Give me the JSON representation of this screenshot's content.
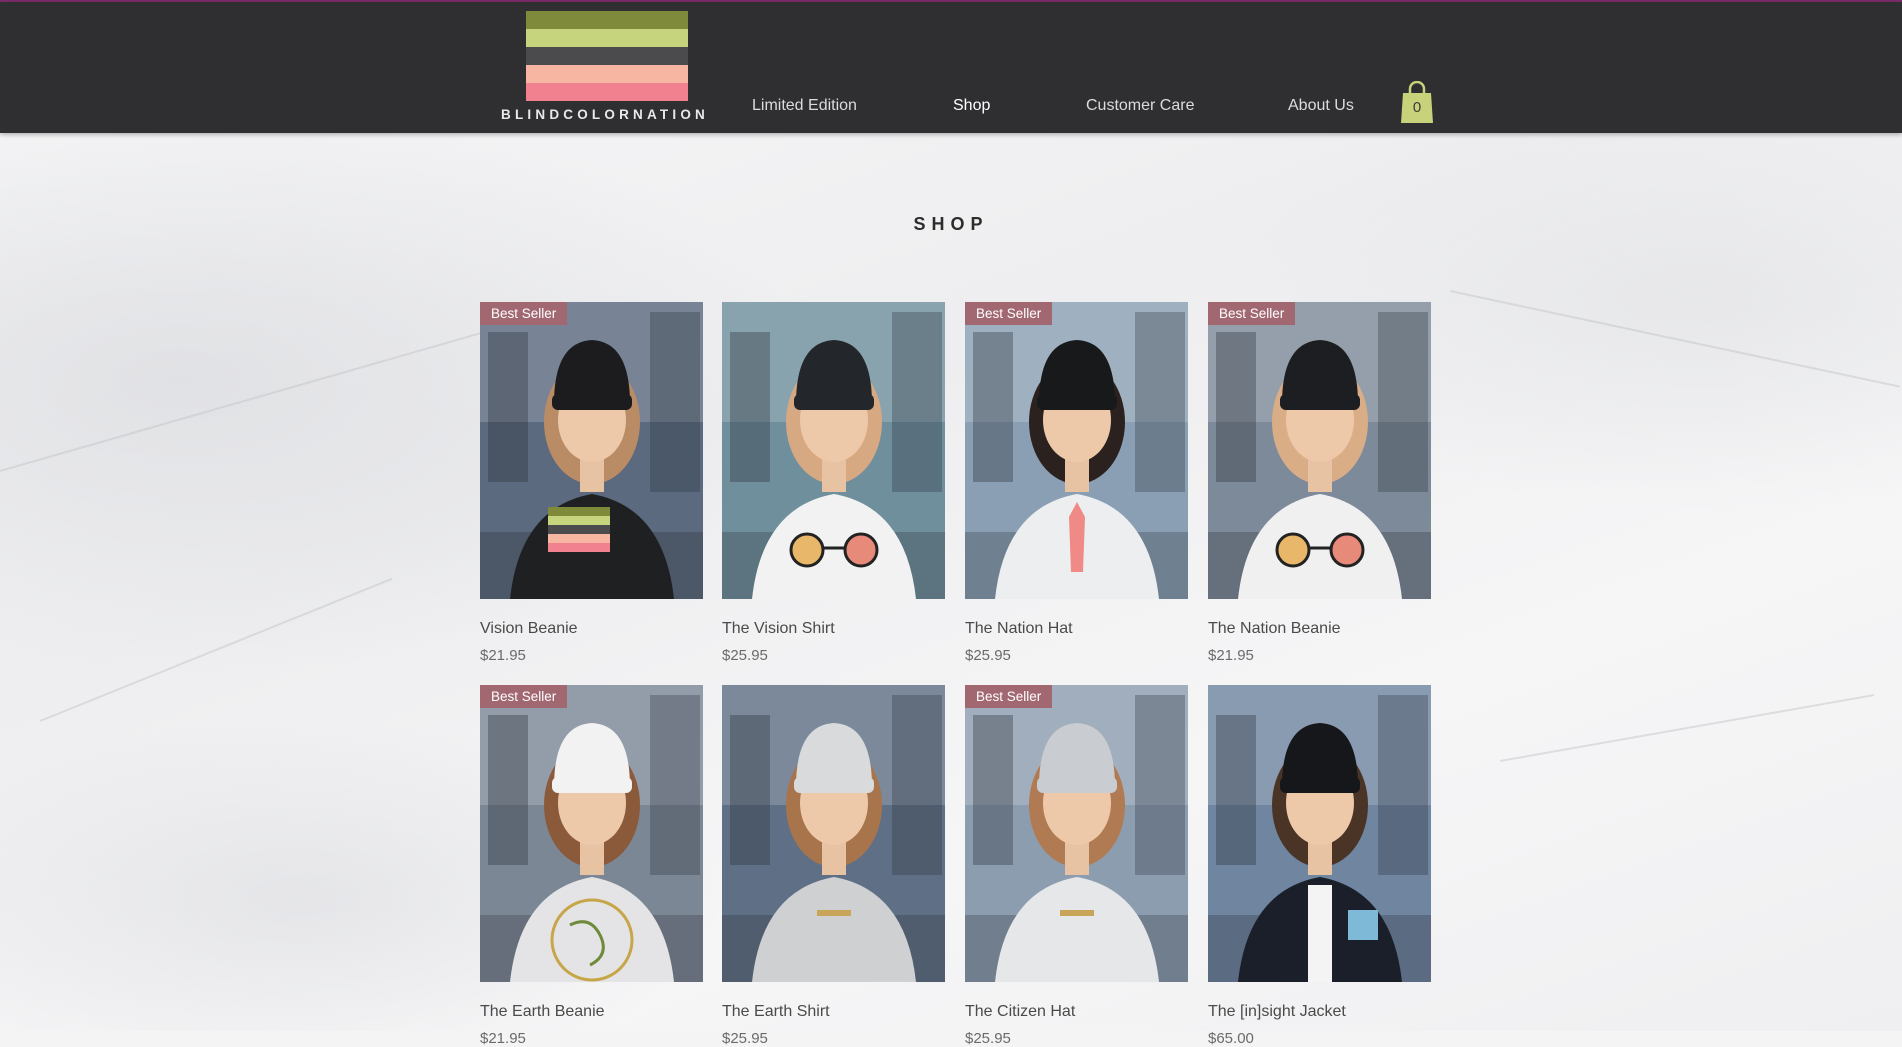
{
  "brand": {
    "name": "BLINDCOLORNATION",
    "stripe_colors": [
      "#7f8a3a",
      "#c6d47e",
      "#4b4b4d",
      "#f7b6a2",
      "#f2818f"
    ]
  },
  "nav": {
    "items": [
      "Limited Edition",
      "Shop",
      "Customer Care",
      "About Us"
    ],
    "active": "Shop"
  },
  "cart": {
    "count": "0",
    "color": "#c8d27a"
  },
  "page": {
    "title": "SHOP"
  },
  "badge_color": "#a26872",
  "products": [
    {
      "name": "Vision Beanie",
      "price": "$21.95",
      "badge": "Best Seller",
      "bg": "#5b6a7e",
      "shirt": "#1f2022",
      "hat": "#1c1c1e",
      "hair": "#b98c66",
      "graphic": "stripes-patch"
    },
    {
      "name": "The Vision Shirt",
      "price": "$25.95",
      "badge": "",
      "bg": "#6f8f9d",
      "shirt": "#f2f2f2",
      "hat": "#23262b",
      "hair": "#d6a982",
      "graphic": "sunglasses"
    },
    {
      "name": "The Nation Hat",
      "price": "$25.95",
      "badge": "Best Seller",
      "bg": "#8a9fb4",
      "shirt": "#eceef0",
      "hat": "#18191b",
      "hair": "#2b2220",
      "graphic": "silhouette"
    },
    {
      "name": "The Nation Beanie",
      "price": "$21.95",
      "badge": "Best Seller",
      "bg": "#7d8a99",
      "shirt": "#f0f0f1",
      "hat": "#1d1e21",
      "hair": "#d9ad86",
      "graphic": "sunglasses"
    },
    {
      "name": "The Earth Beanie",
      "price": "$21.95",
      "badge": "Best Seller",
      "bg": "#7c8796",
      "shirt": "#e4e4e6",
      "hat": "#f2f2f2",
      "hair": "#8a5a3a",
      "graphic": "globe"
    },
    {
      "name": "The Earth Shirt",
      "price": "$25.95",
      "badge": "",
      "bg": "#5f7086",
      "shirt": "#cfd0d2",
      "hat": "#d8dadc",
      "hair": "#a8744c",
      "graphic": "text"
    },
    {
      "name": "The Citizen Hat",
      "price": "$25.95",
      "badge": "Best Seller",
      "bg": "#8d9db0",
      "shirt": "#e6e7e9",
      "hat": "#c9ccd0",
      "hair": "#b07a52",
      "graphic": "text"
    },
    {
      "name": "The [in]sight Jacket",
      "price": "$65.00",
      "badge": "",
      "bg": "#6f85a0",
      "shirt": "#1b1f2a",
      "hat": "#15171b",
      "hair": "#4a3426",
      "graphic": "jacket"
    }
  ]
}
